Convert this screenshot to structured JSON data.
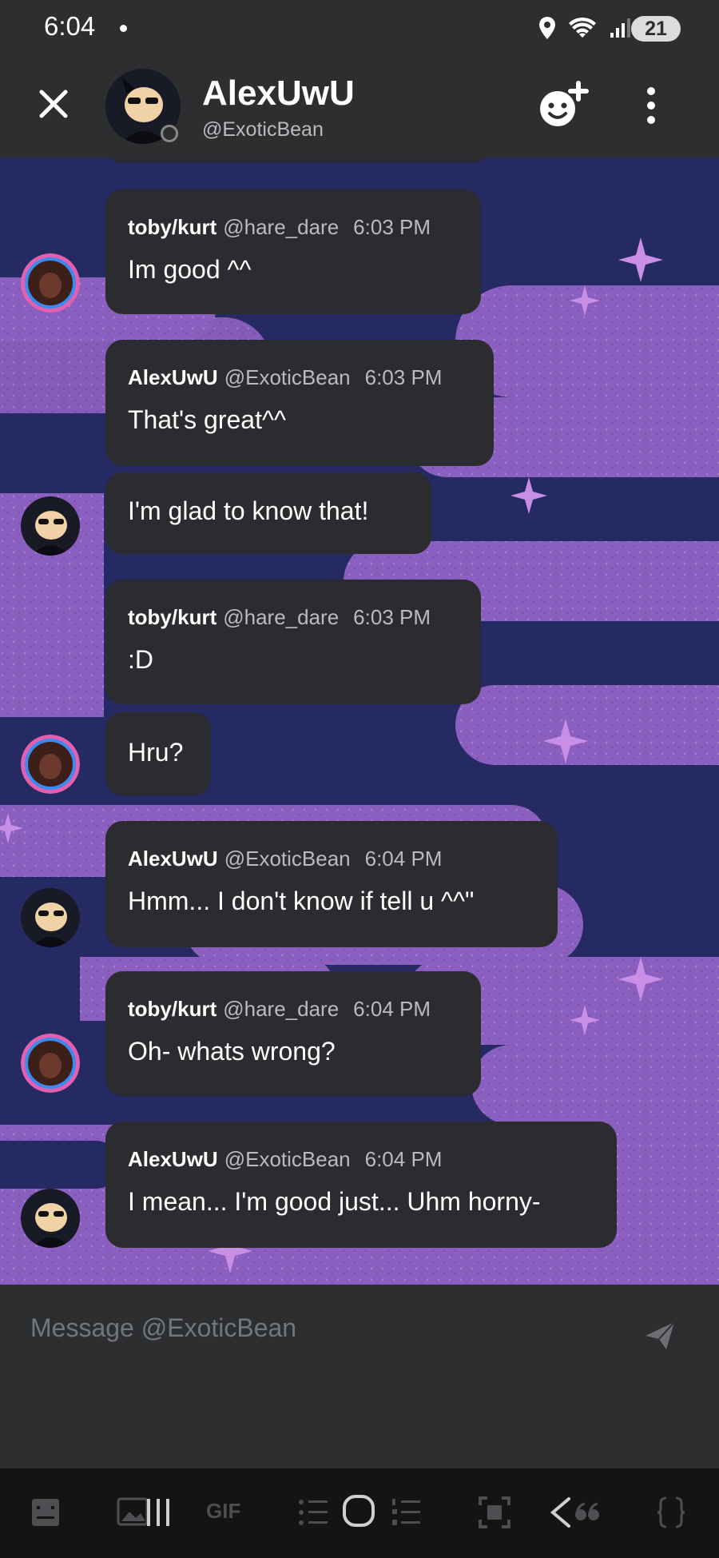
{
  "status_bar": {
    "time": "6:04",
    "battery": "21"
  },
  "header": {
    "name": "AlexUwU",
    "handle": "@ExoticBean"
  },
  "messages": [
    {
      "author": "toby/kurt",
      "handle": "@hare_dare",
      "time": "6:03 PM",
      "lines": [
        "Im good ^^"
      ]
    },
    {
      "author": "AlexUwU",
      "handle": "@ExoticBean",
      "time": "6:03 PM",
      "lines": [
        "That's great^^",
        "I'm glad to know that!"
      ]
    },
    {
      "author": "toby/kurt",
      "handle": "@hare_dare",
      "time": "6:03 PM",
      "lines": [
        ":D",
        "Hru?"
      ]
    },
    {
      "author": "AlexUwU",
      "handle": "@ExoticBean",
      "time": "6:04 PM",
      "lines": [
        "Hmm... I don't know if tell u ^^\""
      ]
    },
    {
      "author": "toby/kurt",
      "handle": "@hare_dare",
      "time": "6:04 PM",
      "lines": [
        "Oh- whats wrong?"
      ]
    },
    {
      "author": "AlexUwU",
      "handle": "@ExoticBean",
      "time": "6:04 PM",
      "lines": [
        "I mean... I'm good just... Uhm horny-"
      ]
    }
  ],
  "composer": {
    "placeholder": "Message @ExoticBean"
  },
  "nav_bar": {
    "gif_label": "GIF"
  },
  "colors": {
    "accent": "#8b5fbf",
    "bubble": "#2b2c2f",
    "background": "#23245a"
  }
}
